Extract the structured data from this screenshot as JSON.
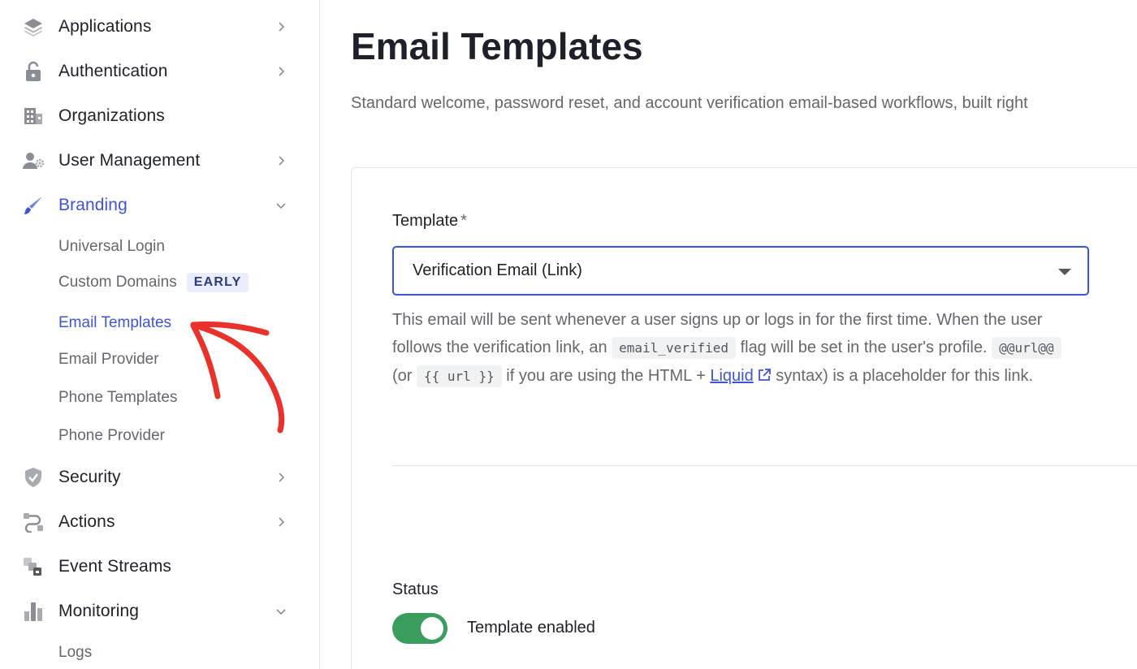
{
  "sidebar": {
    "items": [
      {
        "label": "Applications",
        "icon": "layers-icon"
      },
      {
        "label": "Authentication",
        "icon": "lock-icon"
      },
      {
        "label": "Organizations",
        "icon": "building-icon"
      },
      {
        "label": "User Management",
        "icon": "user-gear-icon"
      },
      {
        "label": "Branding",
        "icon": "brush-icon",
        "expanded": true,
        "active": true
      },
      {
        "label": "Security",
        "icon": "shield-check-icon"
      },
      {
        "label": "Actions",
        "icon": "actions-flow-icon"
      },
      {
        "label": "Event Streams",
        "icon": "event-streams-icon"
      },
      {
        "label": "Monitoring",
        "icon": "bar-chart-icon",
        "expanded": true
      }
    ],
    "branding_subitems": [
      {
        "label": "Universal Login"
      },
      {
        "label": "Custom Domains",
        "badge": "EARLY"
      },
      {
        "label": "Email Templates",
        "active": true
      },
      {
        "label": "Email Provider"
      },
      {
        "label": "Phone Templates"
      },
      {
        "label": "Phone Provider"
      }
    ],
    "monitoring_subitems": [
      {
        "label": "Logs"
      }
    ]
  },
  "main": {
    "title": "Email Templates",
    "description": "Standard welcome, password reset, and account verification email-based workflows, built right",
    "template_field": {
      "label": "Template",
      "required_mark": "*",
      "selected_value": "Verification Email (Link)"
    },
    "help": {
      "part1": "This email will be sent whenever a user signs up or logs in for the first time. When the user follows the verification link, an",
      "code1": "email_verified",
      "part2": "flag will be set in the user's profile.",
      "code2": "@@url@@",
      "part3": "(or",
      "code3": "{{ url }}",
      "part4": "if you are using the HTML +",
      "link": "Liquid",
      "part5": "syntax) is a placeholder for this link."
    },
    "status": {
      "label": "Status",
      "toggle_on": true,
      "toggle_label": "Template enabled"
    }
  },
  "colors": {
    "accent": "#3e55d6",
    "toggle_on": "#3a9d5d",
    "annotation_arrow": "#e8322b"
  }
}
